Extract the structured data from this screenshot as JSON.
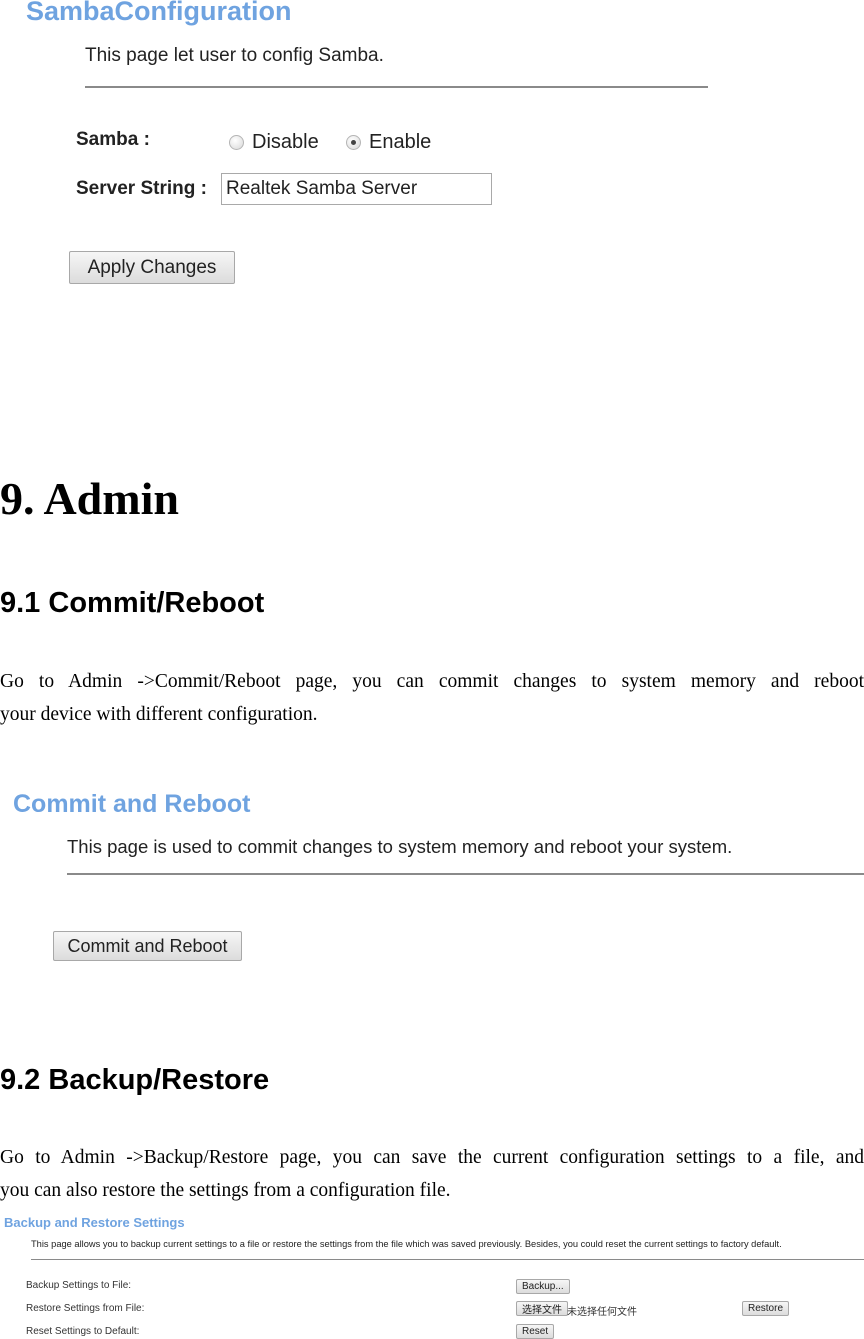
{
  "samba_screenshot": {
    "title": "SambaConfiguration",
    "description": "This page let user to config Samba.",
    "samba_label": "Samba :",
    "options": [
      {
        "label": "Disable",
        "checked": false
      },
      {
        "label": "Enable",
        "checked": true
      }
    ],
    "server_string_label": "Server String :",
    "server_string_value": "Realtek Samba Server",
    "apply_button": "Apply Changes"
  },
  "section": {
    "heading": "9. Admin"
  },
  "commit_reboot": {
    "heading": "9.1 Commit/Reboot",
    "paragraph_line1": "Go to Admin ->Commit/Reboot page, you can commit changes to system memory and reboot",
    "paragraph_line2": "your device with different configuration.",
    "screenshot": {
      "title": "Commit and Reboot",
      "description": "This page is used to commit changes to system memory and reboot your system.",
      "button": "Commit and Reboot"
    }
  },
  "backup_restore": {
    "heading": "9.2 Backup/Restore",
    "paragraph_line1": "Go to Admin ->Backup/Restore page, you can save the current configuration settings to a file, and",
    "paragraph_line2": "you can also restore the settings from a configuration file.",
    "screenshot": {
      "title": "Backup and Restore Settings",
      "description": "This page allows you to backup current settings to a file or restore the settings from the file which was saved previously. Besides, you could reset the current settings to factory default.",
      "rows": [
        {
          "label": "Backup Settings to File:",
          "button": "Backup..."
        },
        {
          "label": "Restore Settings from File:",
          "file_button": "选择文件",
          "file_status": "未选择任何文件",
          "button": "Restore"
        },
        {
          "label": "Reset Settings to Default:",
          "button": "Reset"
        }
      ]
    }
  }
}
